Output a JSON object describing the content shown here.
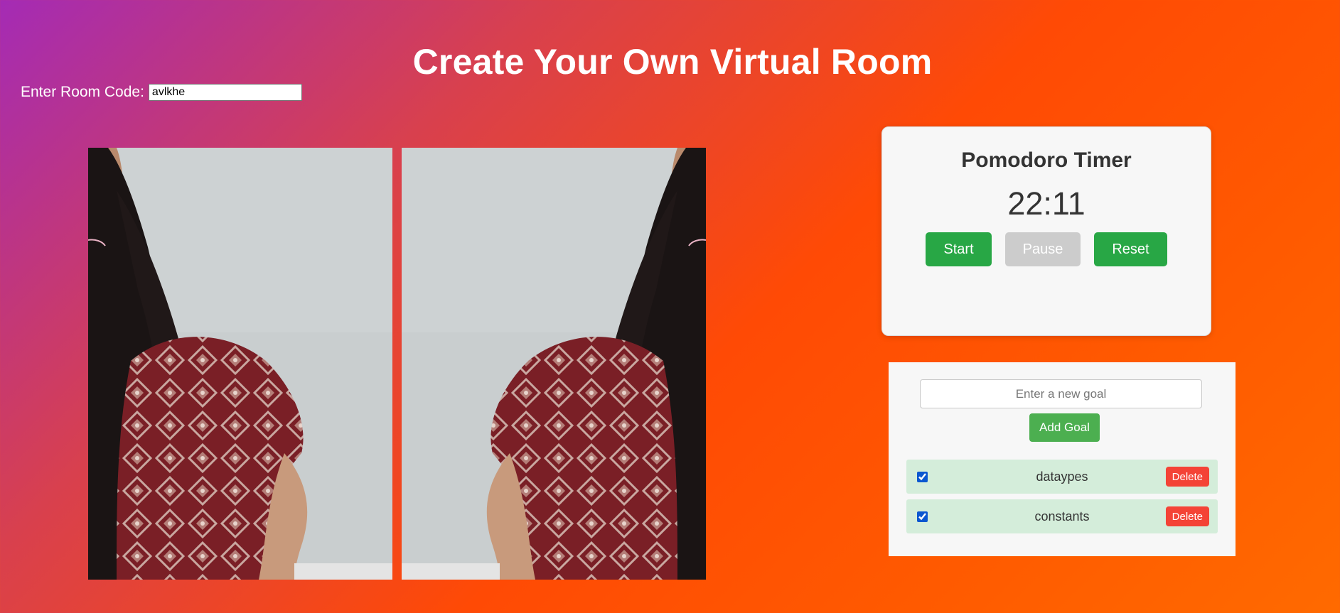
{
  "header": {
    "title": "Create Your Own Virtual Room"
  },
  "room": {
    "label": "Enter Room Code:",
    "code_value": "avlkhe"
  },
  "videos": [
    {
      "name": "local-video-feed",
      "mirrored": false
    },
    {
      "name": "remote-video-feed",
      "mirrored": true
    }
  ],
  "timer": {
    "title": "Pomodoro Timer",
    "display": "22:11",
    "start_label": "Start",
    "pause_label": "Pause",
    "reset_label": "Reset"
  },
  "goals": {
    "input_placeholder": "Enter a new goal",
    "add_label": "Add Goal",
    "items": [
      {
        "text": "dataypes",
        "checked": true,
        "delete_label": "Delete"
      },
      {
        "text": "constants",
        "checked": true,
        "delete_label": "Delete"
      }
    ]
  },
  "colors": {
    "gradient_start": "#a42bb5",
    "gradient_end": "#ff6a00",
    "button_green": "#28a745",
    "add_goal_green": "#4caf50",
    "delete_red": "#f44336",
    "goal_item_bg": "#d4edda"
  }
}
